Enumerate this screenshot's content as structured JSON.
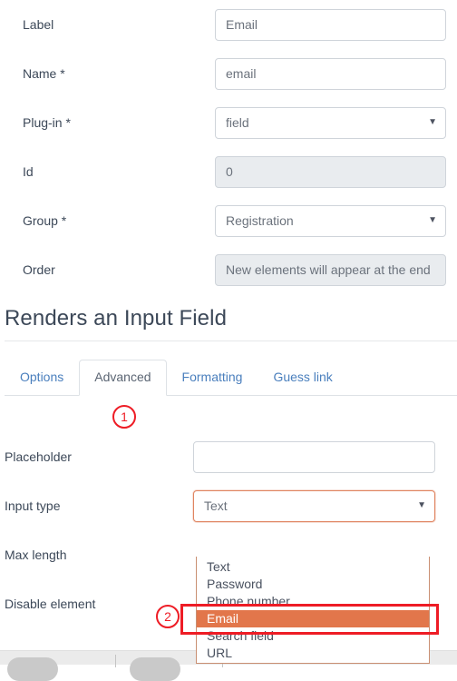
{
  "top_form": {
    "rows": [
      {
        "label": "Label",
        "type": "text",
        "value": "Email",
        "disabled": false
      },
      {
        "label": "Name *",
        "type": "text",
        "value": "email",
        "disabled": false
      },
      {
        "label": "Plug-in *",
        "type": "select",
        "value": "field",
        "disabled": false
      },
      {
        "label": "Id",
        "type": "text",
        "value": "0",
        "disabled": true
      },
      {
        "label": "Group *",
        "type": "select",
        "value": "Registration",
        "disabled": false
      },
      {
        "label": "Order",
        "type": "text",
        "value": "New elements will appear at the end",
        "disabled": true
      }
    ]
  },
  "section": {
    "title": "Renders an Input Field"
  },
  "tabs": {
    "items": [
      {
        "label": "Options",
        "active": false
      },
      {
        "label": "Advanced",
        "active": true
      },
      {
        "label": "Formatting",
        "active": false
      },
      {
        "label": "Guess link",
        "active": false
      }
    ]
  },
  "advanced_form": {
    "rows": [
      {
        "label": "Placeholder"
      },
      {
        "label": "Input type"
      },
      {
        "label": "Max length"
      },
      {
        "label": "Disable element"
      }
    ],
    "placeholder_value": "",
    "placeholder_hint": "",
    "input_type_value": "Text"
  },
  "dropdown": {
    "options": [
      {
        "label": "Text",
        "selected": false
      },
      {
        "label": "Password",
        "selected": false
      },
      {
        "label": "Phone number",
        "selected": false
      },
      {
        "label": "Email",
        "selected": true
      },
      {
        "label": "Search field",
        "selected": false
      },
      {
        "label": "URL",
        "selected": false
      }
    ]
  },
  "annotations": {
    "marker1": "1",
    "marker2": "2"
  },
  "icons": {
    "caret": "▼"
  },
  "colors": {
    "accent_orange": "#e2764b",
    "focus_border": "#e08460",
    "annotation_red": "#ee1c25",
    "tab_link": "#4a7fbd",
    "text": "#3c4858",
    "disabled_bg": "#e9ecef"
  }
}
